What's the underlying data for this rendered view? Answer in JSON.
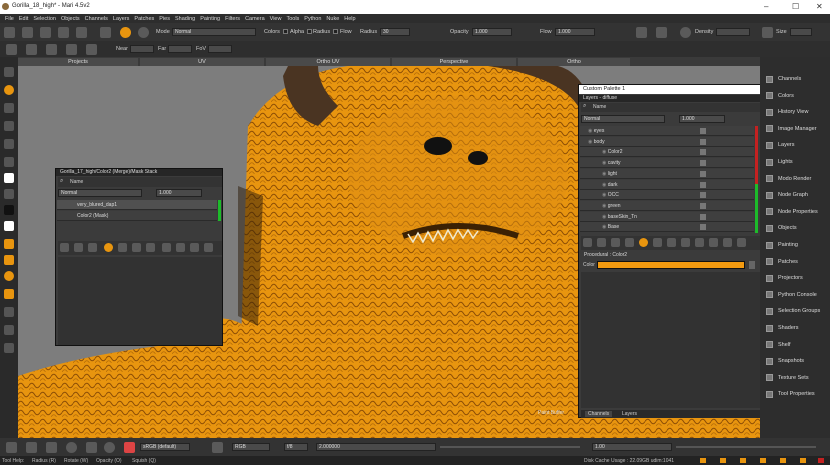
{
  "window": {
    "title": "Gorilla_18_high* - Mari 4.5v2"
  },
  "menus": [
    "File",
    "Edit",
    "Selection",
    "Objects",
    "Channels",
    "Layers",
    "Patches",
    "Pies",
    "Shading",
    "Painting",
    "Filters",
    "Camera",
    "View",
    "Tools",
    "Python",
    "Nuke",
    "Help"
  ],
  "toolbar": {
    "mode_label": "Mode",
    "mode_value": "Normal",
    "colors_label": "Colors",
    "alpha_label": "Alpha",
    "radius_label": "Radius",
    "flow_label": "Flow",
    "radius2_label": "Radius",
    "radius2_value": "30",
    "opacity_label": "Opacity",
    "opacity_value": "1.000",
    "flow2_label": "Flow",
    "flow2_value": "1.000",
    "density_label": "Density",
    "size_label": "Size"
  },
  "toolbar2": {
    "near_label": "Near",
    "far_label": "Far",
    "fov_label": "FoV"
  },
  "view_tabs": [
    "Projects",
    "UV",
    "Ortho UV",
    "Perspective",
    "Ortho"
  ],
  "viewport_tabs": [
    "Channels",
    "Layers"
  ],
  "viewport_text": {
    "corner": "Paint Buffer"
  },
  "mask_stack": {
    "title": "Gorilla_17_high/Color2 (Merge)/Mask Stack",
    "name_label": "Name",
    "blend": "Normal",
    "opacity": "1.000",
    "layers": [
      {
        "name": "very_blured_dap1"
      },
      {
        "name": "Color2 (Mask)"
      }
    ]
  },
  "palette": {
    "title": "Custom Palette 1",
    "subtitle": "Layers - diffuse",
    "name_label": "Name",
    "blend": "Normal",
    "opacity": "1.000",
    "layers": [
      {
        "name": "eyes",
        "indent": 0
      },
      {
        "name": "body",
        "indent": 0
      },
      {
        "name": "Color2",
        "indent": 1
      },
      {
        "name": "cavity",
        "indent": 1
      },
      {
        "name": "light",
        "indent": 1
      },
      {
        "name": "dark",
        "indent": 1
      },
      {
        "name": "OCC",
        "indent": 1
      },
      {
        "name": "green",
        "indent": 1
      },
      {
        "name": "baseSkin_Tn",
        "indent": 1
      },
      {
        "name": "Base",
        "indent": 1
      }
    ],
    "procedural_title": "Procedural : Color2",
    "color_label": "Color",
    "color_value": "#f39a10",
    "tabs": [
      "Channels",
      "Layers"
    ]
  },
  "right_panel": [
    "Channels",
    "Colors",
    "History View",
    "Image Manager",
    "Layers",
    "Lights",
    "Modo Render",
    "Node Graph",
    "Node Properties",
    "Objects",
    "Painting",
    "Patches",
    "Projectors",
    "Python Console",
    "Selection Groups",
    "Shaders",
    "Shelf",
    "Snapshots",
    "Texture Sets",
    "Tool Properties"
  ],
  "bottom": {
    "colorspace": "sRGB (default)",
    "channel": "RGB",
    "fstop": "f/8",
    "gain": "2.000000",
    "exposure": "1.00"
  },
  "status": {
    "tool_help": "Tool Help:",
    "radius": "Radius (R)",
    "rotate": "Rotate (W)",
    "opacity": "Opacity (O)",
    "squish": "Squish (Q)",
    "cache": "Disk Cache Usage : 22.09GB  udim:1041"
  },
  "colors": {
    "skin": "#e8950f",
    "accent": "#f39a10",
    "green": "#1dbb2a",
    "red": "#c42121"
  }
}
